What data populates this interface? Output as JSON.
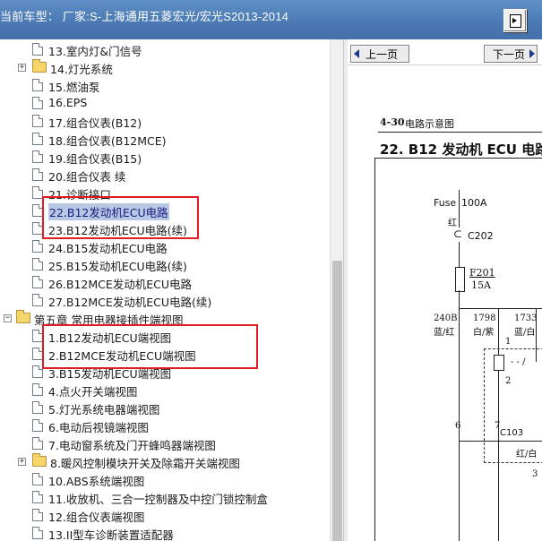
{
  "window": {
    "title": "当前车型：  厂家:S-上海通用五菱宏光/宏光S2013-2014"
  },
  "colors": {
    "titlebar": "#4a79b3",
    "selection": "#b6c8e6",
    "highlight_box": "#e01b22"
  },
  "tree": {
    "items": [
      {
        "label": "13.室内灯&门信号",
        "kind": "doc"
      },
      {
        "label": "14.灯光系统",
        "kind": "folder",
        "expander": "+"
      },
      {
        "label": "15.燃油泵",
        "kind": "doc"
      },
      {
        "label": "16.EPS",
        "kind": "doc"
      },
      {
        "label": "17.组合仪表(B12)",
        "kind": "doc"
      },
      {
        "label": "18.组合仪表(B12MCE)",
        "kind": "doc"
      },
      {
        "label": "19.组合仪表(B15)",
        "kind": "doc"
      },
      {
        "label": "20.组合仪表 续",
        "kind": "doc"
      },
      {
        "label": "21.诊断接口",
        "kind": "doc"
      },
      {
        "label": "22.B12发动机ECU电路",
        "kind": "doc",
        "selected": true
      },
      {
        "label": "23.B12发动机ECU电路(续)",
        "kind": "doc"
      },
      {
        "label": "24.B15发动机ECU电路",
        "kind": "doc"
      },
      {
        "label": "25.B15发动机ECU电路(续)",
        "kind": "doc"
      },
      {
        "label": "26.B12MCE发动机ECU电路",
        "kind": "doc"
      },
      {
        "label": "27.B12MCE发动机ECU电路(续)",
        "kind": "doc"
      },
      {
        "label": "第五章 常用电器接插件端视图",
        "kind": "folder",
        "expander": "−"
      },
      {
        "label": "1.B12发动机ECU端视图",
        "kind": "doc"
      },
      {
        "label": "2.B12MCE发动机ECU端视图",
        "kind": "doc"
      },
      {
        "label": "3.B15发动机ECU端视图",
        "kind": "doc"
      },
      {
        "label": "4.点火开关端视图",
        "kind": "doc"
      },
      {
        "label": "5.灯光系统电器端视图",
        "kind": "doc"
      },
      {
        "label": "6.电动后视镜端视图",
        "kind": "doc"
      },
      {
        "label": "7.电动窗系统及门开蜂鸣器端视图",
        "kind": "doc"
      },
      {
        "label": "8.暖风控制模块开关及除霜开关端视图",
        "kind": "folder",
        "expander": "+"
      },
      {
        "label": "10.ABS系统端视图",
        "kind": "doc"
      },
      {
        "label": "11.收放机、三合一控制器及中控门锁控制盒",
        "kind": "doc"
      },
      {
        "label": "12.组合仪表端视图",
        "kind": "doc"
      },
      {
        "label": "13.II型车诊断装置适配器",
        "kind": "doc"
      }
    ]
  },
  "viewer": {
    "prev_label": "上一页",
    "next_label": "下一页",
    "section_number": "4-30",
    "section_title": "电路示意图",
    "diagram_title": "22.  B12 发动机 ECU 电路",
    "fuse_label": "Fuse",
    "fuse_rating": "100A",
    "wire_red": "红",
    "connector_c202": "C202",
    "fuse_f201": "F201",
    "fuse_f201_rating": "15A",
    "wire1_code": "240B",
    "wire1_color": "蓝/红",
    "wire2_code": "1798",
    "wire2_color": "白/紫",
    "wire3_code": "1733",
    "wire3_color": "蓝/白",
    "relay_pin1": "1",
    "relay_pin2": "2",
    "connector_c103": "C103",
    "pin6": "6",
    "pin7": "7",
    "wire_bottom_color": "红/白",
    "pin3": "3"
  }
}
